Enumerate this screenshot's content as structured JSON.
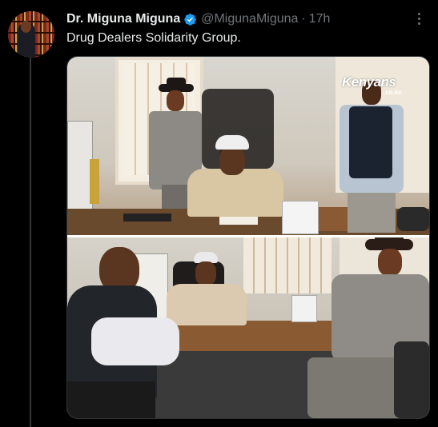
{
  "author": {
    "display_name": "Dr. Miguna Miguna",
    "handle": "@MigunaMiguna",
    "separator": "·",
    "time": "17h",
    "verified_color": "#1d9bf0"
  },
  "tweet": {
    "text": "Drug Dealers Solidarity Group."
  },
  "media": {
    "watermark": "Kenyans",
    "watermark_sub": ".co.ke"
  },
  "icons": {
    "verified": "verified-badge-icon",
    "more": "more-options-icon"
  }
}
